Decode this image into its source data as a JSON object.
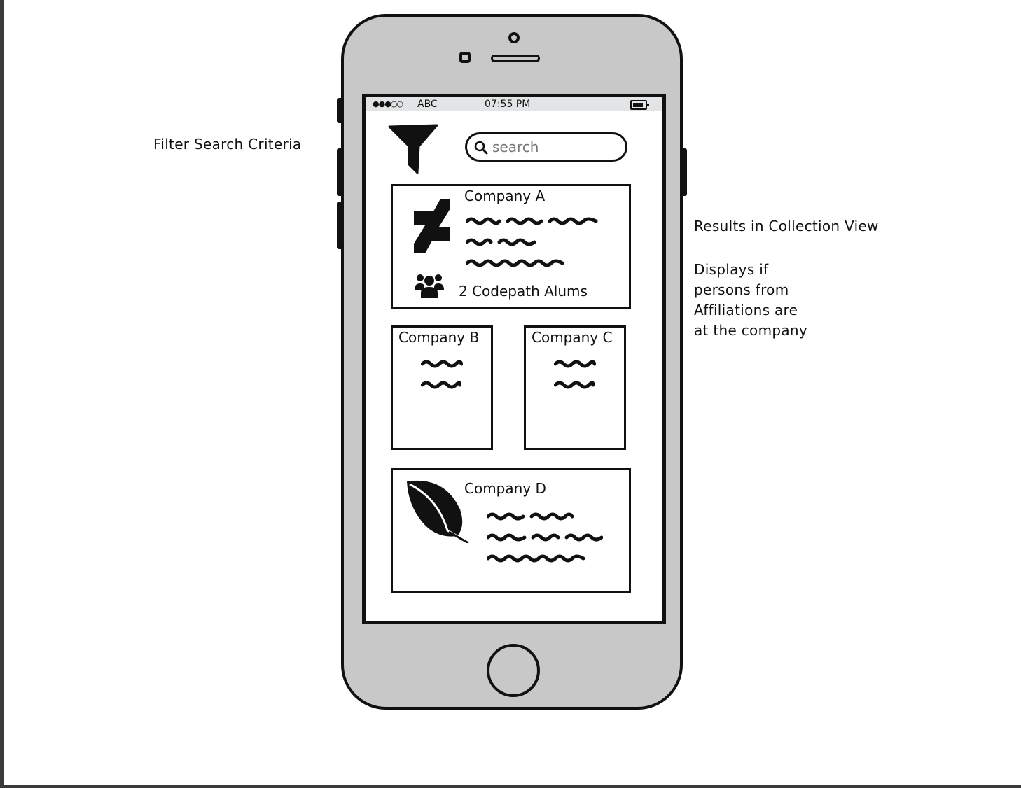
{
  "annotations": {
    "filter_note": "Filter Search Criteria",
    "results_note": "Results in Collection View",
    "displays_note": [
      "Displays if",
      "persons from",
      "Affiliations are",
      "at the company"
    ]
  },
  "status_bar": {
    "signal": "●●●○○",
    "carrier": "ABC",
    "time": "07:55 PM"
  },
  "search": {
    "placeholder": "search",
    "value": ""
  },
  "icons": {
    "filter": "filter-funnel-icon",
    "search": "magnifier-icon",
    "company_a_logo": "deviantart-logo-icon",
    "alums": "people-group-icon",
    "company_d_logo": "leaf-icon"
  },
  "results": {
    "company_a": {
      "title": "Company A",
      "alums_label": "2 Codepath Alums"
    },
    "company_b": {
      "title": "Company B"
    },
    "company_c": {
      "title": "Company C"
    },
    "company_d": {
      "title": "Company D"
    }
  },
  "colors": {
    "phone_body": "#c8c8c8",
    "outline": "#111111",
    "status_bar": "#e2e4e6"
  }
}
